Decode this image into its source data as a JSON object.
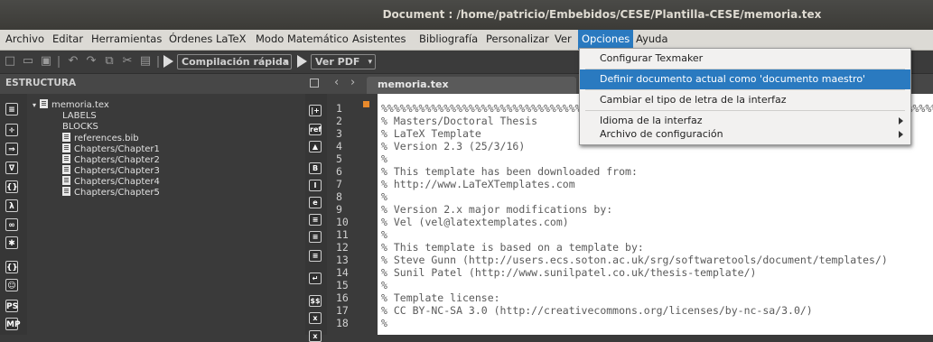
{
  "window": {
    "title": "Document : /home/patricio/Embebidos/CESE/Plantilla-CESE/memoria.tex"
  },
  "menubar": [
    {
      "label": "Archivo"
    },
    {
      "label": "Editar"
    },
    {
      "label": "Herramientas"
    },
    {
      "label": "Órdenes LaTeX"
    },
    {
      "label": "Modo Matemático"
    },
    {
      "label": "Asistentes"
    },
    {
      "label": "Bibliografía"
    },
    {
      "label": "Personalizar"
    },
    {
      "label": "Ver"
    },
    {
      "label": "Opciones"
    },
    {
      "label": "Ayuda"
    }
  ],
  "toolbar": {
    "quick_build": "Compilación rápida",
    "view_pdf": "Ver PDF"
  },
  "structure": {
    "header": "ESTRUCTURA",
    "items": [
      {
        "label": "memoria.tex"
      },
      {
        "label": "LABELS"
      },
      {
        "label": "BLOCKS"
      },
      {
        "label": "references.bib"
      },
      {
        "label": "Chapters/Chapter1"
      },
      {
        "label": "Chapters/Chapter2"
      },
      {
        "label": "Chapters/Chapter3"
      },
      {
        "label": "Chapters/Chapter4"
      },
      {
        "label": "Chapters/Chapter5"
      }
    ]
  },
  "editor": {
    "tab": "memoria.tex",
    "line_numbers": [
      "1",
      "2",
      "3",
      "4",
      "5",
      "6",
      "7",
      "8",
      "9",
      "10",
      "11",
      "12",
      "13",
      "14",
      "15",
      "16",
      "17",
      "18"
    ],
    "lines": [
      "%%%%%%%%%%%%%%%%%%%%%%%%%%%%%%%%%%%%%%%%%%%%%%%%%%%%%%%%%%%%%%%%%%%%%%%%%%%%%%%%%%%%%%%%%%%%%%%%%%%%%%%%%%",
      "% Masters/Doctoral Thesis",
      "% LaTeX Template",
      "% Version 2.3 (25/3/16)",
      "%",
      "% This template has been downloaded from:",
      "% http://www.LaTeXTemplates.com",
      "%",
      "% Version 2.x major modifications by:",
      "% Vel (vel@latextemplates.com)",
      "%",
      "% This template is based on a template by:",
      "% Steve Gunn (http://users.ecs.soton.ac.uk/srg/softwaretools/document/templates/)",
      "% Sunil Patel (http://www.sunilpatel.co.uk/thesis-template/)",
      "%",
      "% Template license:",
      "% CC BY-NC-SA 3.0 (http://creativecommons.org/licenses/by-nc-sa/3.0/)",
      "%"
    ]
  },
  "options_menu": {
    "items": [
      {
        "label": "Configurar Texmaker"
      },
      {
        "label": "Definir documento actual como 'documento maestro'"
      },
      {
        "label": "Cambiar el tipo de letra de la interfaz"
      },
      {
        "label": "Idioma de la interfaz"
      },
      {
        "label": "Archivo de configuración"
      }
    ]
  },
  "colors": {
    "accent": "#2a7ac0",
    "fold_marker": "#e88a2c"
  }
}
